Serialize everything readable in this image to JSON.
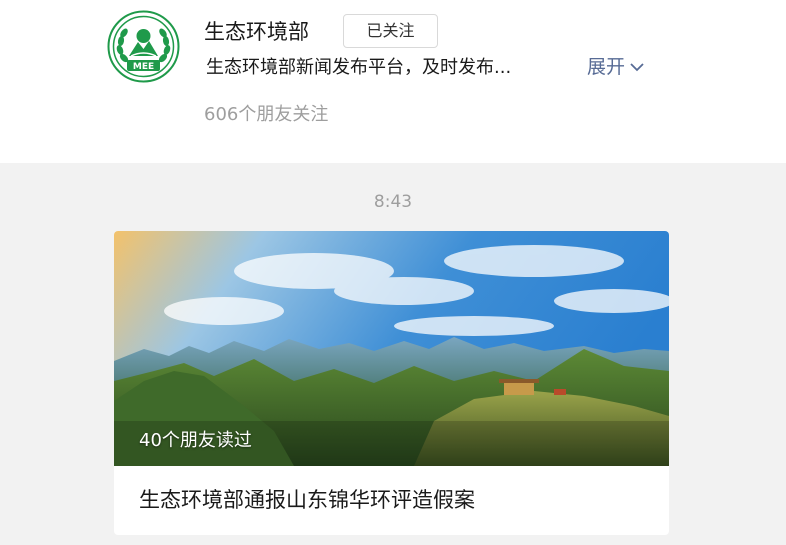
{
  "profile": {
    "name": "生态环境部",
    "follow_label": "已关注",
    "description": "生态环境部新闻发布平台，及时发布...",
    "expand_label": "展开",
    "friends_following": "606个朋友关注",
    "logo_text": "MEE",
    "logo_color": "#1f9a4a"
  },
  "feed": {
    "timestamp": "8:43",
    "article": {
      "read_by_friends": "40个朋友读过",
      "title": "生态环境部通报山东锦华环评造假案"
    }
  },
  "colors": {
    "link": "#576b95",
    "muted": "#9e9e9e",
    "page_bg": "#f2f2f2"
  }
}
